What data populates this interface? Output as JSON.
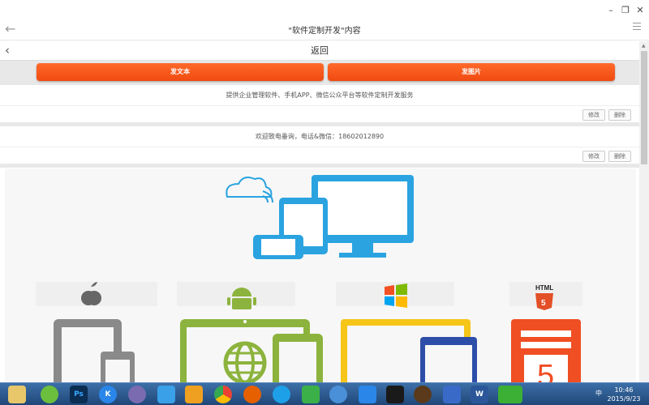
{
  "window": {
    "controls": {
      "min": "–",
      "max": "❐",
      "close": "✕"
    }
  },
  "appbar": {
    "title": "\"软件定制开发\"内容",
    "back_icon": "arrow-left-icon",
    "menu_icon": "hamburger-icon"
  },
  "backbar": {
    "label": "返回"
  },
  "actions": {
    "post_text": "发文本",
    "post_image": "发图片"
  },
  "posts": [
    {
      "text": "提供企业管理软件、手机APP、微信公众平台等软件定制开发服务",
      "edit": "修改",
      "delete": "删除"
    },
    {
      "text": "欢迎致电垂询，电话&微信：18602012890",
      "edit": "修改",
      "delete": "删除"
    }
  ],
  "banner": {
    "html5_label": "HTML"
  },
  "ime": {
    "label": "中"
  },
  "taskbar": {
    "apps": [
      "file-explorer",
      "browser-360",
      "photoshop",
      "kuwo",
      "ime-app",
      "pen-app",
      "360-safe",
      "chrome",
      "firefox",
      "ie",
      "download-app",
      "cloud-app",
      "xunlei-app",
      "eye-app",
      "game-app",
      "remote-desktop",
      "word",
      "wechat"
    ],
    "ps_label": "Ps",
    "word_label": "W",
    "k_label": "K",
    "tray_label": "中",
    "time": "10:46",
    "date": "2015/9/23"
  },
  "colors": {
    "accent": "#f25a18",
    "banner_blue": "#2aa3e0",
    "taskbar": "#2a5a94"
  }
}
